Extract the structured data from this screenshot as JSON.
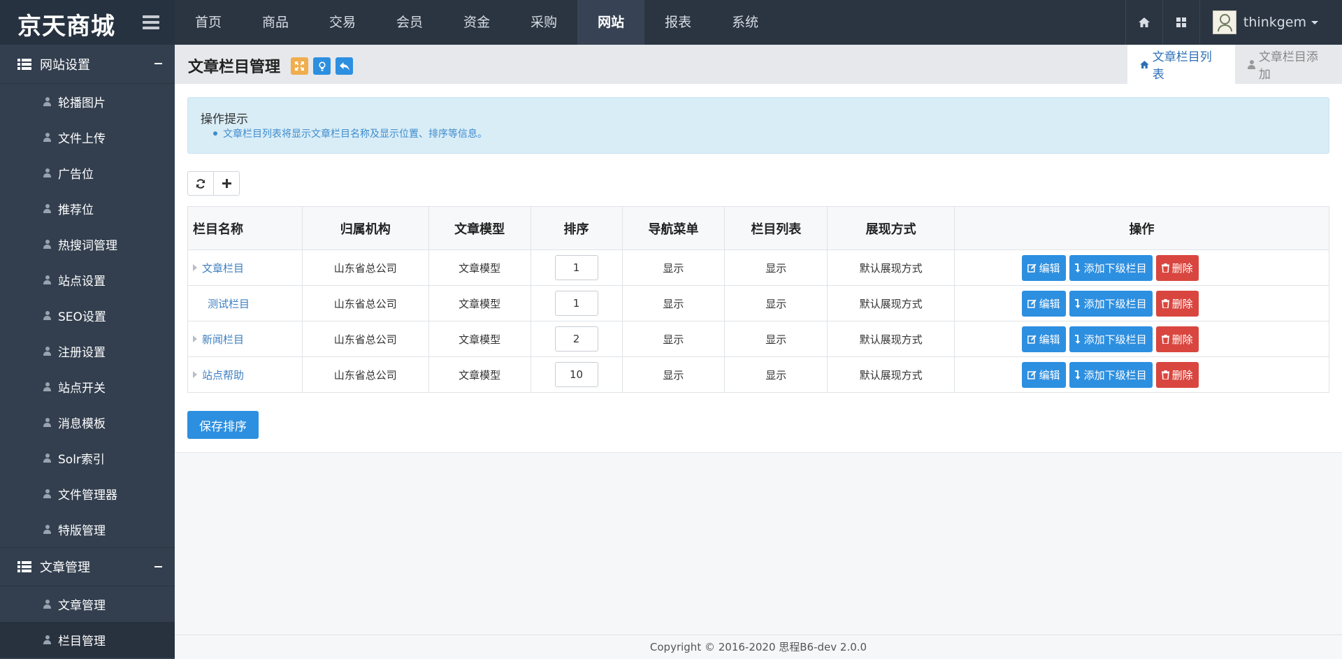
{
  "brand": {
    "logo": "京天商城"
  },
  "nav": {
    "items": [
      "首页",
      "商品",
      "交易",
      "会员",
      "资金",
      "采购",
      "网站",
      "报表",
      "系统"
    ],
    "active": "网站"
  },
  "user": {
    "name": "thinkgem"
  },
  "sidebar": {
    "groups": [
      {
        "label": "网站设置",
        "items": [
          "轮播图片",
          "文件上传",
          "广告位",
          "推荐位",
          "热搜词管理",
          "站点设置",
          "SEO设置",
          "注册设置",
          "站点开关",
          "消息模板",
          "Solr索引",
          "文件管理器",
          "特版管理"
        ]
      },
      {
        "label": "文章管理",
        "items": [
          "文章管理",
          "栏目管理"
        ],
        "active_item": "栏目管理"
      }
    ]
  },
  "page": {
    "title": "文章栏目管理",
    "tabs": {
      "list": "文章栏目列表",
      "add": "文章栏目添加"
    }
  },
  "tips": {
    "title": "操作提示",
    "line": "文章栏目列表将显示文章栏目名称及显示位置、排序等信息。"
  },
  "table": {
    "headers": [
      "栏目名称",
      "归属机构",
      "文章模型",
      "排序",
      "导航菜单",
      "栏目列表",
      "展现方式",
      "操作"
    ],
    "rows": [
      {
        "name": "文章栏目",
        "org": "山东省总公司",
        "model": "文章模型",
        "sort": "1",
        "nav": "显示",
        "list": "显示",
        "mode": "默认展现方式",
        "expandable": true
      },
      {
        "name": "测试栏目",
        "org": "山东省总公司",
        "model": "文章模型",
        "sort": "1",
        "nav": "显示",
        "list": "显示",
        "mode": "默认展现方式",
        "expandable": false
      },
      {
        "name": "新闻栏目",
        "org": "山东省总公司",
        "model": "文章模型",
        "sort": "2",
        "nav": "显示",
        "list": "显示",
        "mode": "默认展现方式",
        "expandable": true
      },
      {
        "name": "站点帮助",
        "org": "山东省总公司",
        "model": "文章模型",
        "sort": "10",
        "nav": "显示",
        "list": "显示",
        "mode": "默认展现方式",
        "expandable": true
      }
    ],
    "actions": {
      "edit": "编辑",
      "add_child": "添加下级栏目",
      "delete": "删除"
    }
  },
  "save_button": "保存排序",
  "footer": "Copyright © 2016-2020  思程B6-dev  2.0.0",
  "icons": {
    "refresh": "refresh-icon",
    "plus": "plus-icon",
    "home": "home-icon",
    "grid": "grid-icon"
  },
  "colors": {
    "primary": "#2d8fe0",
    "danger": "#d9463f",
    "topbar": "#2b3542",
    "sidebar": "#333f4f",
    "orange": "#f0ad4e"
  }
}
